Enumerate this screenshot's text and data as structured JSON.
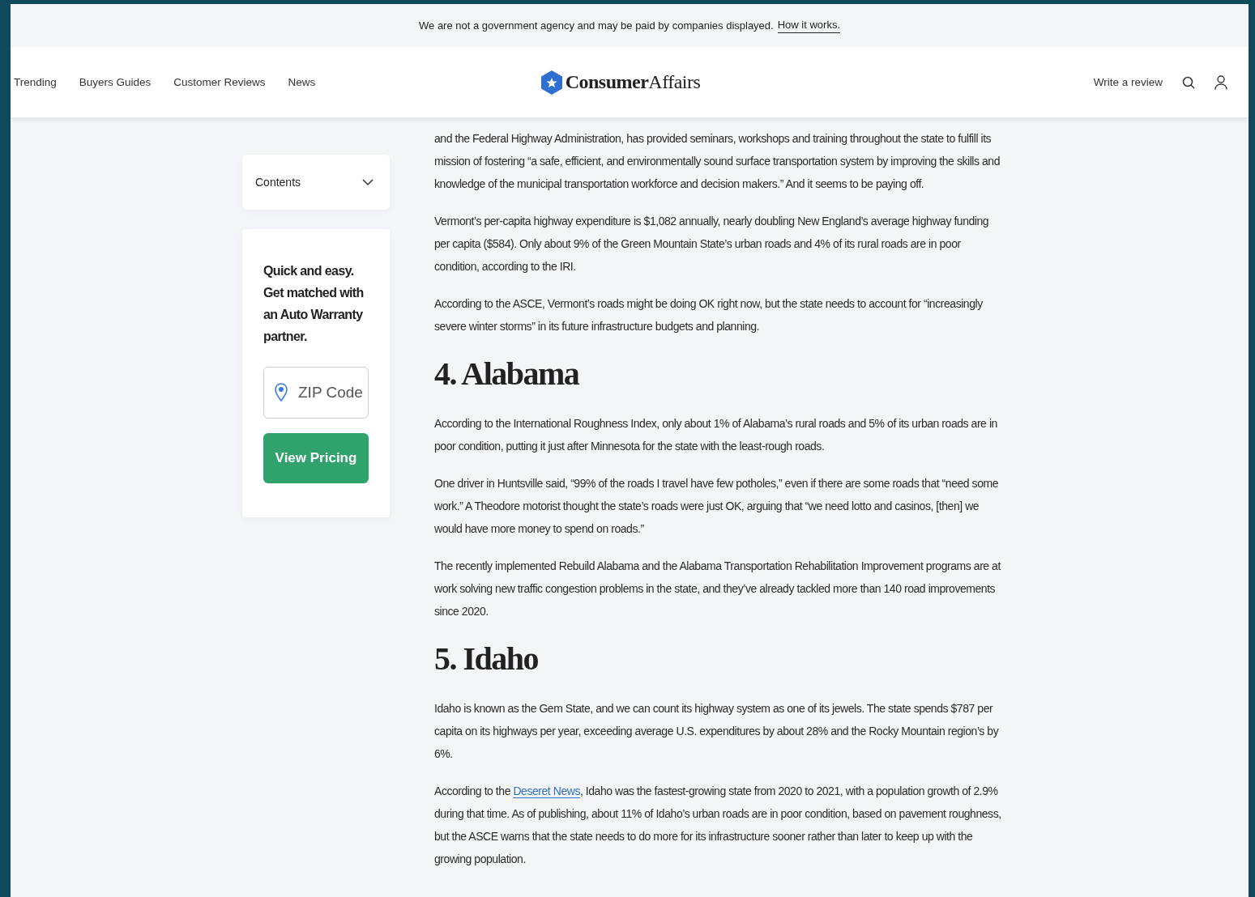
{
  "notice": {
    "text": "We are not a government agency and may be paid by companies displayed.",
    "link": "How it works."
  },
  "nav": {
    "items": [
      "Trending",
      "Buyers Guides",
      "Customer Reviews",
      "News"
    ],
    "logo": {
      "bold": "Consumer",
      "regular": "Affairs"
    },
    "write_review": "Write a review"
  },
  "sidebar": {
    "contents": {
      "label": "Contents",
      "expanded": false
    },
    "promo": {
      "text": "Quick and easy. Get matched with an Auto Warranty partner.",
      "zip": {
        "placeholder": "ZIP Code"
      },
      "button": "View Pricing"
    }
  },
  "article": [
    {
      "kind": "p",
      "text": "and the Federal Highway Administration, has provided seminars, workshops and training throughout the state to fulfill its mission of fostering “a safe, efficient, and environmentally sound surface transportation system by improving the skills and knowledge of the municipal transportation workforce and decision makers.” And it seems to be paying off."
    },
    {
      "kind": "p",
      "text": "Vermont’s per-capita highway expenditure is $1,082 annually, nearly doubling New England’s average highway funding per capita ($584). Only about 9% of the Green Mountain State’s urban roads and 4% of its rural roads are in poor condition, according to the IRI."
    },
    {
      "kind": "p",
      "text": "According to the ASCE, Vermont’s roads might be doing OK right now, but the state needs to account for “increasingly severe winter storms” in its future infrastructure budgets and planning."
    },
    {
      "kind": "h",
      "text": "4. Alabama"
    },
    {
      "kind": "p",
      "text": "According to the International Roughness Index, only about 1% of Alabama’s rural roads and 5% of its urban roads are in poor condition, putting it just after Minnesota for the state with the least-rough roads."
    },
    {
      "kind": "p",
      "text": "One driver in Huntsville said, “99% of the roads I travel have few potholes,” even if there are some roads that “need some work.” A Theodore motorist thought the state’s roads were just OK, arguing that “we need lotto and casinos, [then] we would have more money to spend on roads.”"
    },
    {
      "kind": "p",
      "text": "The recently implemented Rebuild Alabama and the Alabama Transportation Rehabilitation Improvement programs are at work solving new traffic congestion problems in the state, and they’ve already tackled more than 140 road improvements since 2020."
    },
    {
      "kind": "h",
      "text": "5. Idaho"
    },
    {
      "kind": "p",
      "text": "Idaho is known as the Gem State, and we can count its highway system as one of its jewels. The state spends $787 per capita on its highways per year, exceeding average U.S. expenditures by about 28% and the Rocky Mountain region’s by 6%."
    },
    {
      "kind": "link_p",
      "before": "According to the",
      "link": "Deseret News",
      "after": ", Idaho was the fastest-growing state from 2020 to 2021, with a population growth of 2.9% during that time. As of publishing, about 11% of Idaho’s urban roads are in poor condition, based on pavement roughness, but the ASCE warns that the state needs to do more for its infrastructure sooner rather than later to keep up with the growing population."
    }
  ]
}
